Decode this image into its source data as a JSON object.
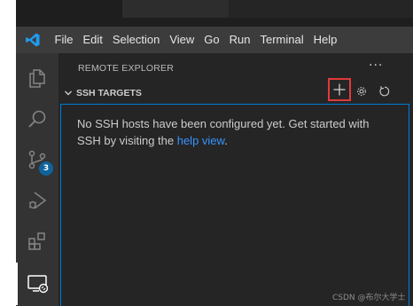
{
  "menubar": {
    "items": [
      "File",
      "Edit",
      "Selection",
      "View",
      "Go",
      "Run",
      "Terminal",
      "Help"
    ]
  },
  "activity_bar": {
    "items": [
      {
        "name": "explorer",
        "icon": "files-icon"
      },
      {
        "name": "search",
        "icon": "search-icon"
      },
      {
        "name": "source-control",
        "icon": "source-control-icon",
        "badge": "3"
      },
      {
        "name": "run-debug",
        "icon": "run-debug-icon"
      },
      {
        "name": "extensions",
        "icon": "extensions-icon"
      },
      {
        "name": "remote-explorer",
        "icon": "remote-explorer-icon",
        "active": true
      }
    ]
  },
  "sidebar": {
    "title": "REMOTE EXPLORER",
    "more_actions": "···",
    "section": {
      "title": "SSH TARGETS",
      "actions": [
        "add-icon",
        "gear-icon",
        "refresh-icon"
      ]
    },
    "message": {
      "text_before": "No SSH hosts have been configured yet. Get started with SSH by visiting the ",
      "link": "help view",
      "text_after": "."
    }
  },
  "watermark": "CSDN @布尔大学士",
  "colors": {
    "menubar_bg": "#3c3c3c",
    "activitybar_bg": "#333333",
    "sidebar_bg": "#252526",
    "focus_border": "#007fd4",
    "link": "#3794ff",
    "highlight_box": "#e03a3a",
    "badge": "#0e639c"
  }
}
